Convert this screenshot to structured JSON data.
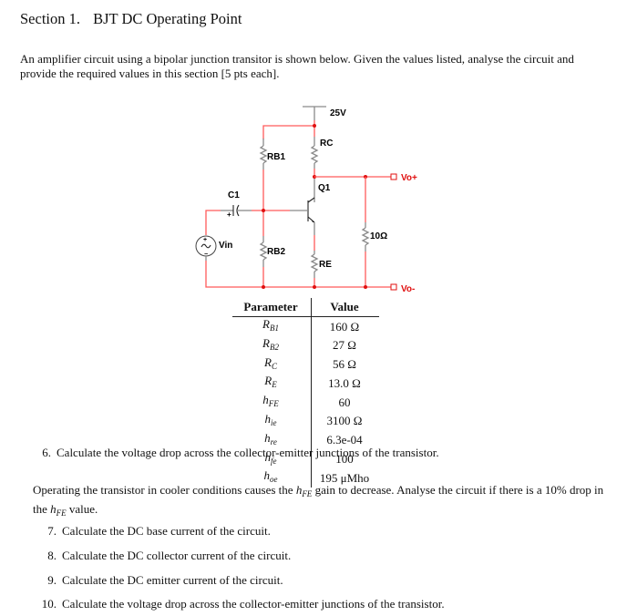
{
  "section": {
    "number": "Section 1.",
    "title": "BJT DC Operating Point"
  },
  "intro": "An amplifier circuit using a bipolar junction transitor is shown below. Given the values listed, analyse the circuit and provide the required values in this section [5 pts each].",
  "circuit": {
    "supply_label": "25V",
    "rc_label": "RC",
    "rb1_label": "RB1",
    "rb2_label": "RB2",
    "re_label": "RE",
    "q1_label": "Q1",
    "c1_label": "C1",
    "vin_label": "Vin",
    "load_label": "10Ω",
    "vo_plus_label": "Vo+",
    "vo_minus_label": "Vo-",
    "wire_color": "#ff5a5a",
    "node_color": "#e01010"
  },
  "table": {
    "headers": [
      "Parameter",
      "Value"
    ],
    "rows": [
      {
        "param": "R",
        "sub": "B1",
        "value": "160 Ω"
      },
      {
        "param": "R",
        "sub": "B2",
        "value": "27 Ω"
      },
      {
        "param": "R",
        "sub": "C",
        "value": "56 Ω"
      },
      {
        "param": "R",
        "sub": "E",
        "value": "13.0 Ω"
      },
      {
        "param": "h",
        "sub": "FE",
        "value": "60"
      },
      {
        "param": "h",
        "sub": "ie",
        "value": "3100 Ω"
      },
      {
        "param": "h",
        "sub": "re",
        "value": "6.3e-04"
      },
      {
        "param": "h",
        "sub": "fe",
        "value": "100"
      },
      {
        "param": "h",
        "sub": "oe",
        "value": "195 μMho"
      }
    ]
  },
  "question6": {
    "num": "6.",
    "text": "Calculate the voltage drop across the collector-emitter junctions of the transistor."
  },
  "cooler": {
    "part1": "Operating the transistor in cooler conditions causes the ",
    "sym": "h",
    "sub": "FE",
    "part2": " gain to decrease. Analyse the circuit if there is a 10% drop in the ",
    "part3": " value."
  },
  "questions": [
    {
      "num": "7.",
      "text": "Calculate the DC base current of the circuit."
    },
    {
      "num": "8.",
      "text": "Calculate the DC collector current of the circuit."
    },
    {
      "num": "9.",
      "text": "Calculate the DC emitter current of the circuit."
    },
    {
      "num": "10.",
      "text": "Calculate the voltage drop across the collector-emitter junctions of the transistor."
    }
  ]
}
